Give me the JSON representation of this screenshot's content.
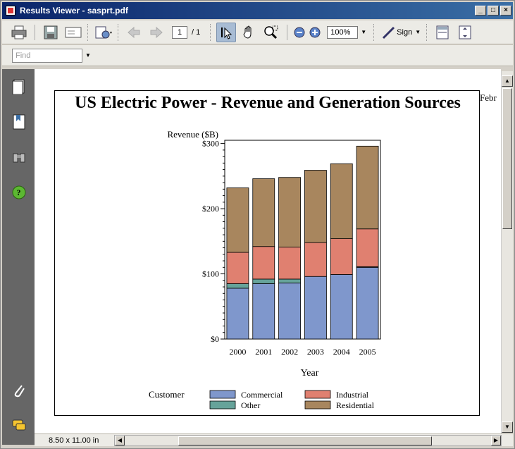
{
  "window": {
    "title": "Results Viewer - sasprt.pdf"
  },
  "toolbar": {
    "page_current": "1",
    "page_total_label": "/ 1",
    "zoom": "100%",
    "sign_label": "Sign"
  },
  "find": {
    "placeholder": "Find"
  },
  "status": {
    "page_size": "8.50 x 11.00 in"
  },
  "document": {
    "truncated_header": "Febr"
  },
  "chart_data": {
    "type": "bar",
    "stacked": true,
    "title": "US Electric Power - Revenue and Generation Sources",
    "ylabel": "Revenue ($B)",
    "xlabel": "Year",
    "categories": [
      "2000",
      "2001",
      "2002",
      "2003",
      "2004",
      "2005"
    ],
    "y_ticks": [
      "$0",
      "$100",
      "$200",
      "$300"
    ],
    "ylim": [
      0,
      305
    ],
    "legend_title": "Customer",
    "legend_placement": "bottom",
    "series": [
      {
        "name": "Commercial",
        "color": "#7f97cc",
        "values": [
          78,
          85,
          86,
          96,
          99,
          110
        ]
      },
      {
        "name": "Other",
        "color": "#66a39a",
        "values": [
          7,
          7,
          6,
          0,
          0,
          1
        ]
      },
      {
        "name": "Industrial",
        "color": "#e08070",
        "values": [
          48,
          50,
          49,
          52,
          55,
          58
        ]
      },
      {
        "name": "Residential",
        "color": "#a8865e",
        "values": [
          99,
          104,
          107,
          111,
          115,
          127
        ]
      }
    ],
    "legend_order": [
      "Commercial",
      "Industrial",
      "Other",
      "Residential"
    ]
  }
}
